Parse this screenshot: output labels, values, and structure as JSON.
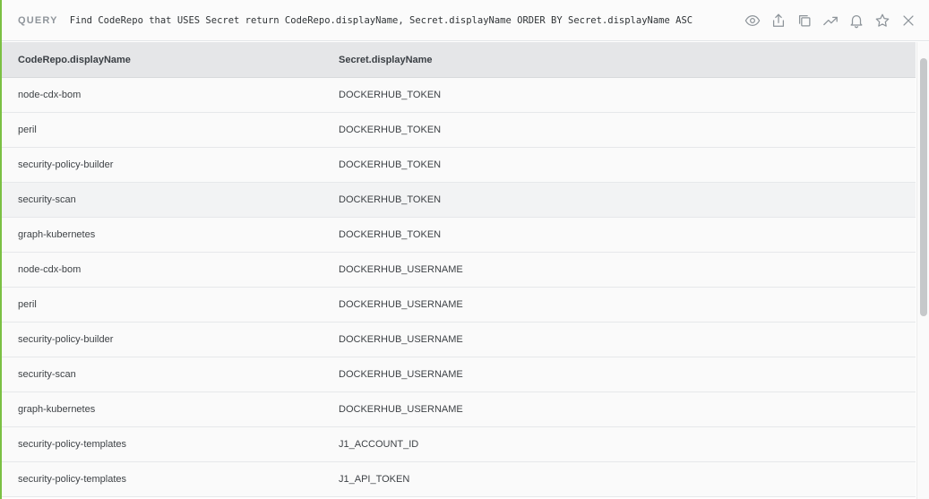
{
  "query": {
    "label": "QUERY",
    "text": "Find CodeRepo that USES Secret return CodeRepo.displayName, Secret.displayName ORDER BY Secret.displayName ASC"
  },
  "actions": [
    "eye-icon",
    "share-icon",
    "copy-icon",
    "trend-icon",
    "bell-icon",
    "star-icon",
    "close-icon"
  ],
  "table": {
    "columns": [
      "CodeRepo.displayName",
      "Secret.displayName"
    ],
    "rows": [
      [
        "node-cdx-bom",
        "DOCKERHUB_TOKEN"
      ],
      [
        "peril",
        "DOCKERHUB_TOKEN"
      ],
      [
        "security-policy-builder",
        "DOCKERHUB_TOKEN"
      ],
      [
        "security-scan",
        "DOCKERHUB_TOKEN"
      ],
      [
        "graph-kubernetes",
        "DOCKERHUB_TOKEN"
      ],
      [
        "node-cdx-bom",
        "DOCKERHUB_USERNAME"
      ],
      [
        "peril",
        "DOCKERHUB_USERNAME"
      ],
      [
        "security-policy-builder",
        "DOCKERHUB_USERNAME"
      ],
      [
        "security-scan",
        "DOCKERHUB_USERNAME"
      ],
      [
        "graph-kubernetes",
        "DOCKERHUB_USERNAME"
      ],
      [
        "security-policy-templates",
        "J1_ACCOUNT_ID"
      ],
      [
        "security-policy-templates",
        "J1_API_TOKEN"
      ]
    ],
    "hovered_row": 3
  },
  "colors": {
    "accent": "#7bc043",
    "header_bg": "#e5e6e8"
  }
}
